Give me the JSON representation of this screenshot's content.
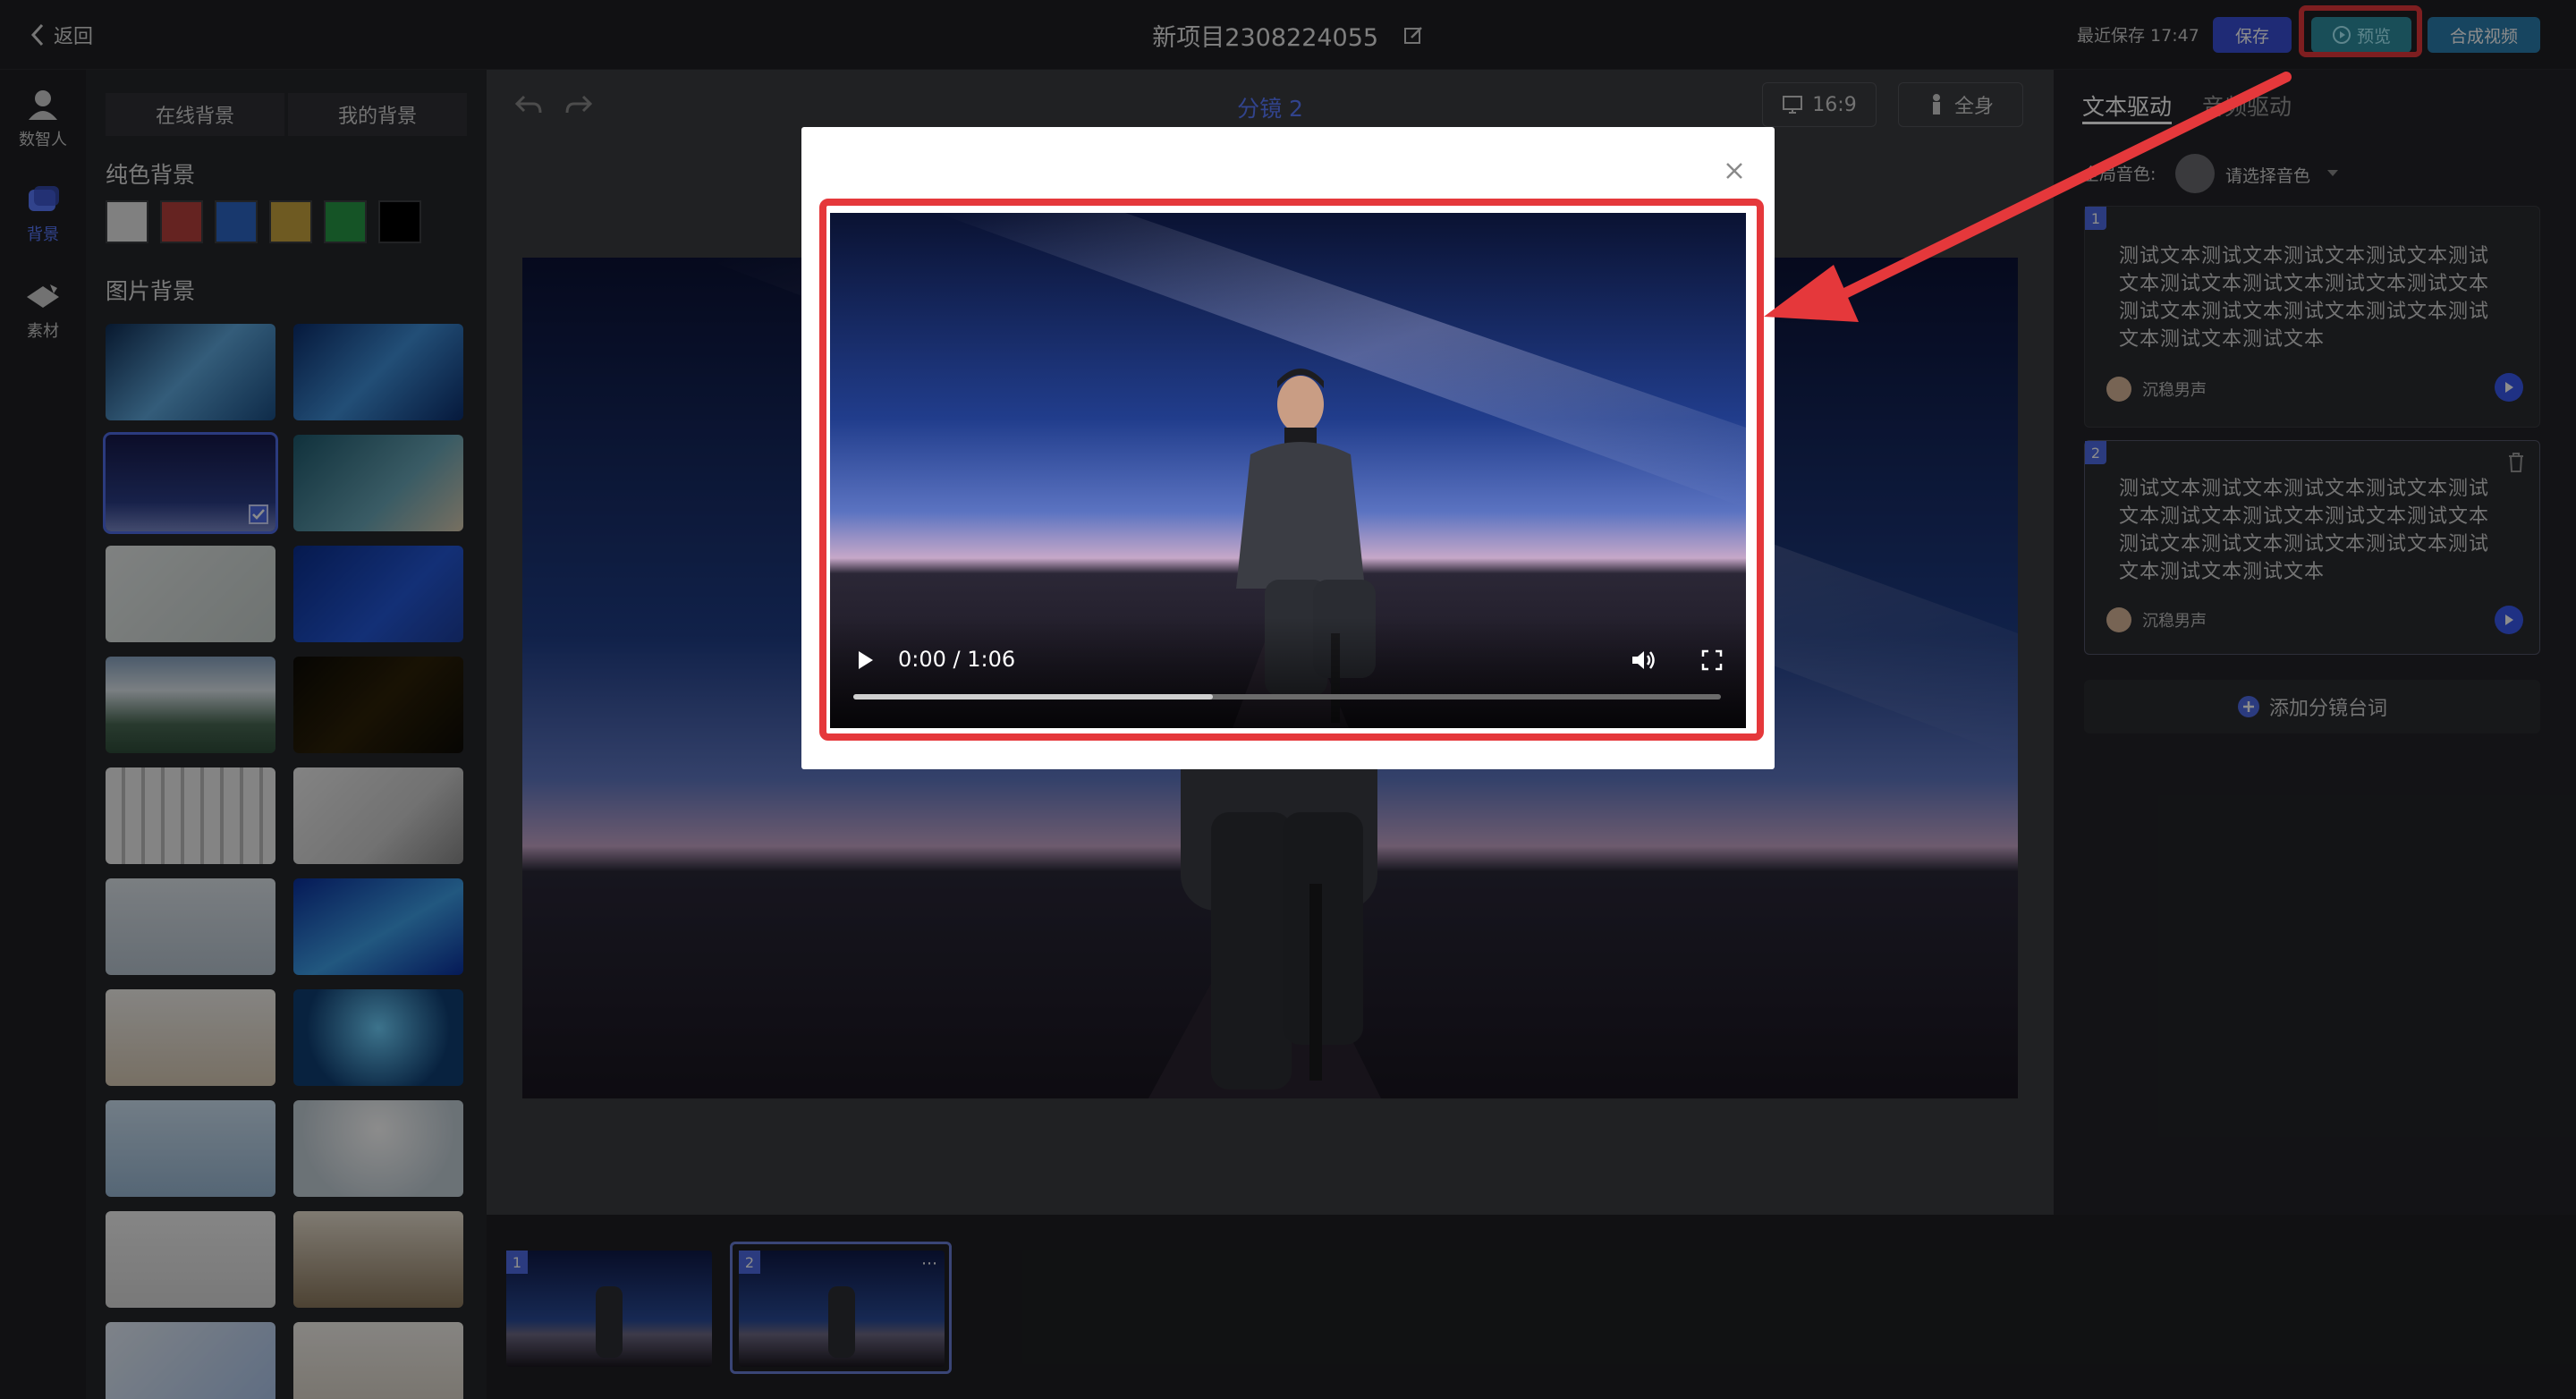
{
  "header": {
    "back_label": "返回",
    "project_title": "新项目2308224055",
    "last_saved": "最近保存 17:47",
    "save_label": "保存",
    "preview_label": "预览",
    "compose_label": "合成视频"
  },
  "rail": {
    "items": [
      {
        "label": "数智人",
        "icon": "person-icon"
      },
      {
        "label": "背景",
        "icon": "background-icon",
        "active": true
      },
      {
        "label": "素材",
        "icon": "material-icon"
      }
    ]
  },
  "background_panel": {
    "tabs": [
      "在线背景",
      "我的背景"
    ],
    "solid_heading": "纯色背景",
    "solid_colors": [
      "#e9e9e9",
      "#b8413d",
      "#2d67c6",
      "#c8a43e",
      "#279a45",
      "#000000"
    ],
    "image_heading": "图片背景"
  },
  "canvas": {
    "title": "分镜 2",
    "ratio_label": "16:9",
    "body_label": "全身"
  },
  "right_panel": {
    "tabs": [
      "文本驱动",
      "音频驱动"
    ],
    "global_voice_label": "全局音色:",
    "voice_placeholder": "请选择音色",
    "cards": [
      {
        "num": "1",
        "text": "测试文本测试文本测试文本测试文本测试文本测试文本测试文本测试文本测试文本测试文本测试文本测试文本测试文本测试文本测试文本测试文本",
        "voice": "沉稳男声"
      },
      {
        "num": "2",
        "text": "测试文本测试文本测试文本测试文本测试文本测试文本测试文本测试文本测试文本测试文本测试文本测试文本测试文本测试文本测试文本测试文本",
        "voice": "沉稳男声"
      }
    ],
    "add_label": "添加分镜台词"
  },
  "filmstrip": {
    "items": [
      {
        "num": "1"
      },
      {
        "num": "2",
        "active": true
      }
    ]
  },
  "modal": {
    "player": {
      "time": "0:00 / 1:06",
      "buffered_fraction": 0.38
    }
  },
  "colors": {
    "accent": "#4f6ce8",
    "highlight": "#e5383b",
    "preview_btn": "#2f8fa0"
  }
}
